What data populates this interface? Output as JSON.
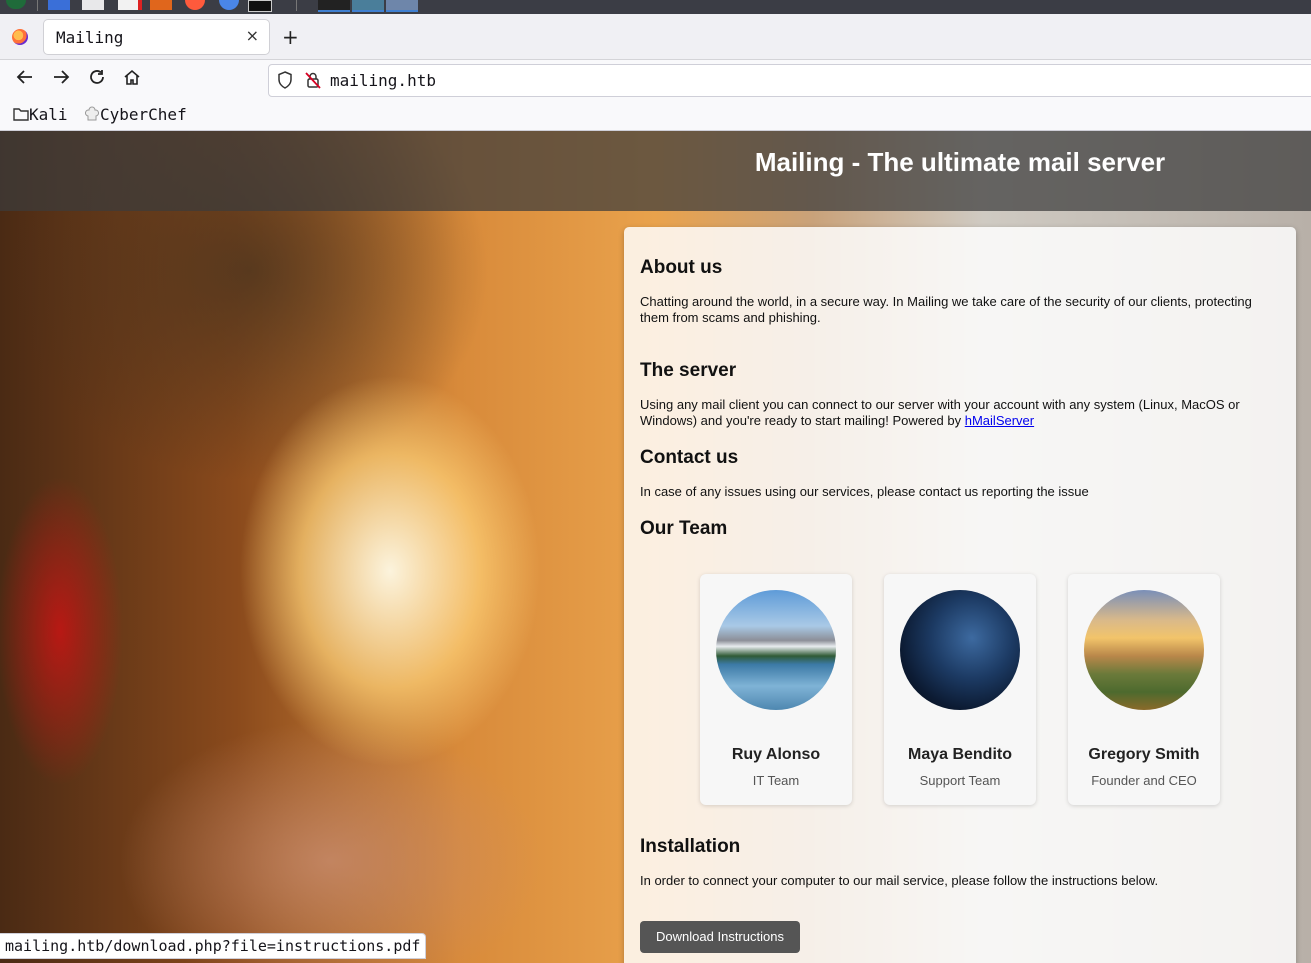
{
  "browser": {
    "tab_title": "Mailing",
    "tab_close": "×",
    "new_tab": "+",
    "url": "mailing.htb",
    "bookmarks": [
      {
        "label": "Kali",
        "icon": "folder-icon"
      },
      {
        "label": "CyberChef",
        "icon": "chef-hat-icon"
      }
    ],
    "status_url": "mailing.htb/download.php?file=instructions.pdf"
  },
  "page": {
    "title": "Mailing - The ultimate mail server",
    "about": {
      "heading": "About us",
      "text": "Chatting around the world, in a secure way. In Mailing we take care of the security of our clients, protecting them from scams and phishing."
    },
    "server": {
      "heading": "The server",
      "text": "Using any mail client you can connect to our server with your account with any system (Linux, MacOS or Windows) and you're ready to start mailing! Powered by ",
      "link": "hMailServer"
    },
    "contact": {
      "heading": "Contact us",
      "text": "In case of any issues using our services, please contact us reporting the issue"
    },
    "team": {
      "heading": "Our Team",
      "members": [
        {
          "name": "Ruy Alonso",
          "role": "IT Team",
          "photo": "mountain-lake"
        },
        {
          "name": "Maya Bendito",
          "role": "Support Team",
          "photo": "night-sky"
        },
        {
          "name": "Gregory Smith",
          "role": "Founder and CEO",
          "photo": "sunset-hills"
        }
      ]
    },
    "installation": {
      "heading": "Installation",
      "text": "In order to connect your computer to our mail service, please follow the instructions below.",
      "button": "Download Instructions"
    }
  },
  "colors": {
    "link": "#0000ee",
    "button_bg": "#555555",
    "header_overlay": "#3c3c3c"
  }
}
